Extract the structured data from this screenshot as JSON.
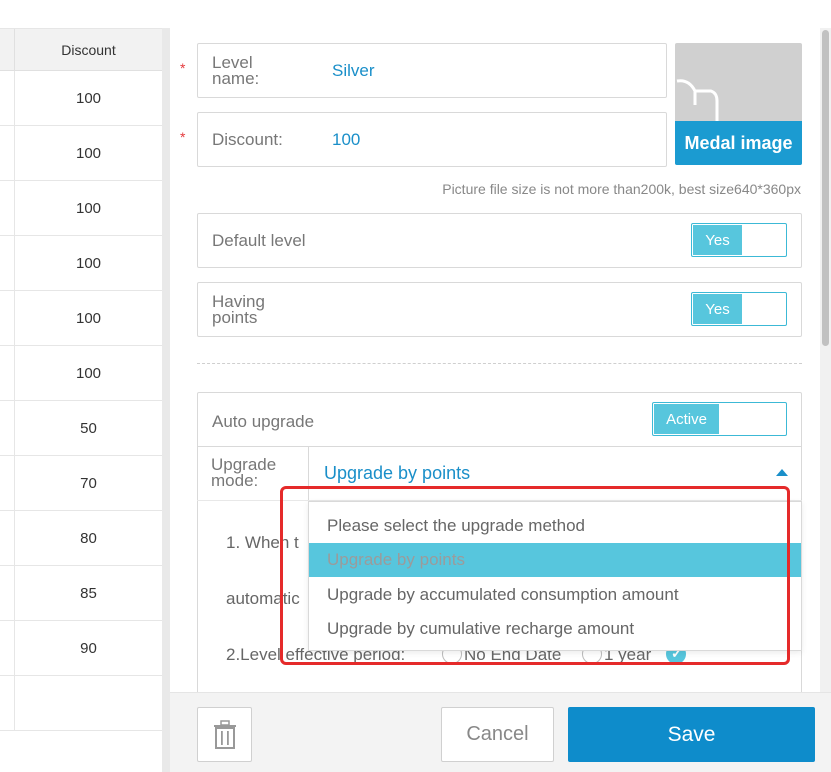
{
  "table": {
    "header": "Discount",
    "rows": [
      "100",
      "100",
      "100",
      "100",
      "100",
      "100",
      "50",
      "70",
      "80",
      "85",
      "90",
      ""
    ]
  },
  "form": {
    "level_name_label": "Level name:",
    "level_name_value": "Silver",
    "discount_label": "Discount:",
    "discount_value": "100",
    "required_mark": "*",
    "medal_label": "Medal image",
    "picture_hint": "Picture file size is not more than200k, best size640*360px",
    "default_level_label": "Default level",
    "default_level_toggle": "Yes",
    "having_points_label": "Having points",
    "having_points_toggle": "Yes",
    "auto_upgrade_label": "Auto upgrade",
    "auto_upgrade_toggle": "Active",
    "upgrade_mode_label": "Upgrade mode:",
    "upgrade_mode_value": "Upgrade by points",
    "rule_line1": "1. When t",
    "rule_line2": "automatic",
    "rule_line3_prefix": "2.Level effective period:",
    "rule_opt_no_end": "No End Date",
    "rule_opt_1year": "1 year"
  },
  "dropdown": {
    "options": [
      "Please select the upgrade method",
      "Upgrade by points",
      "Upgrade by accumulated consumption amount",
      "Upgrade by cumulative recharge amount"
    ],
    "selected_index": 1
  },
  "footer": {
    "cancel_label": "Cancel",
    "save_label": "Save"
  },
  "colors": {
    "accent": "#0e8ccb",
    "toggle_on": "#57c6dd",
    "highlight_box": "#e52a2a"
  }
}
